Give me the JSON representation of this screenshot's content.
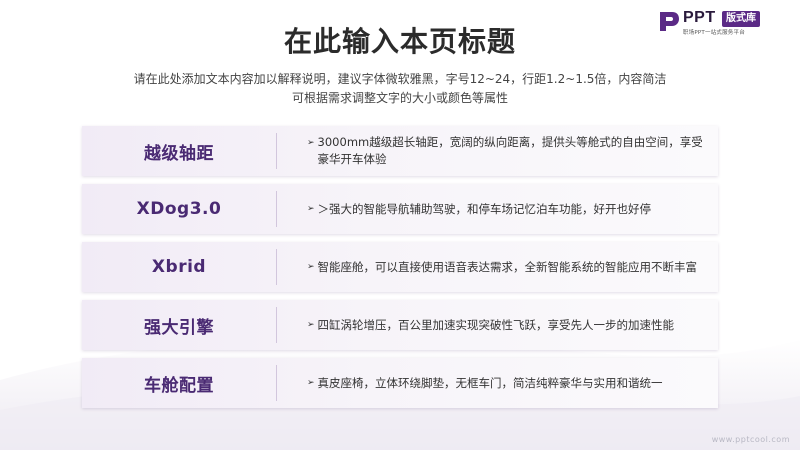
{
  "logo": {
    "brand": "PPT",
    "badge": "版式库",
    "tagline": "职场PPT一站式服务平台",
    "brand_color": "#5b2a86"
  },
  "title": "在此输入本页标题",
  "subtitle": {
    "line1": "请在此处添加文本内容加以解释说明，建议字体微软雅黑，字号12~24，行距1.2~1.5倍，内容简洁",
    "line2": "可根据需求调整文字的大小或颜色等属性"
  },
  "rows": [
    {
      "label": "越级轴距",
      "description": "3000mm越级超长轴距，宽阔的纵向距离，提供头等舱式的自由空间，享受豪华开车体验"
    },
    {
      "label": "XDog3.0",
      "description": "＞强大的智能导航辅助驾驶，和停车场记忆泊车功能，好开也好停"
    },
    {
      "label": "Xbrid",
      "description": "智能座舱，可以直接使用语音表达需求，全新智能系统的智能应用不断丰富"
    },
    {
      "label": "强大引擎",
      "description": "四缸涡轮增压，百公里加速实现突破性飞跃，享受先人一步的加速性能"
    },
    {
      "label": "车舱配置",
      "description": "真皮座椅，立体环绕脚垫，无框车门，简洁纯粹豪华与实用和谐统一"
    }
  ],
  "bullet_icon": "arrow-bullet-icon",
  "footer": {
    "url": "www.pptcool.com"
  },
  "colors": {
    "label": "#4a2a73",
    "row_bg": "#f1ebf6"
  }
}
